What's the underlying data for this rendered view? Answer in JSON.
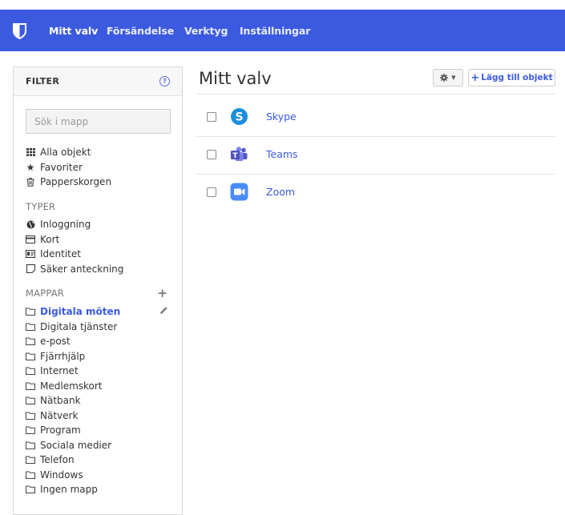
{
  "nav": {
    "items": [
      "Mitt valv",
      "Försändelse",
      "Verktyg",
      "Inställningar"
    ],
    "active": "Mitt valv",
    "brand_color": "#3c5ae0"
  },
  "sidebar": {
    "title": "FILTER",
    "help_icon": "question-circle-icon",
    "search_placeholder": "Sök i mapp",
    "all_items": [
      {
        "label": "Alla objekt",
        "icon": "grid-icon"
      },
      {
        "label": "Favoriter",
        "icon": "star-icon"
      },
      {
        "label": "Papperskorgen",
        "icon": "trash-icon"
      }
    ],
    "types_label": "TYPER",
    "types": [
      {
        "label": "Inloggning",
        "icon": "globe-icon"
      },
      {
        "label": "Kort",
        "icon": "credit-card-icon"
      },
      {
        "label": "Identitet",
        "icon": "id-card-icon"
      },
      {
        "label": "Säker anteckning",
        "icon": "note-icon"
      }
    ],
    "folders_label": "MAPPAR",
    "folders": [
      "Digitala möten",
      "Digitala tjänster",
      "e-post",
      "Fjärrhjälp",
      "Internet",
      "Medlemskort",
      "Nätbank",
      "Nätverk",
      "Program",
      "Sociala medier",
      "Telefon",
      "Windows",
      "Ingen mapp"
    ],
    "active_folder": "Digitala möten"
  },
  "main": {
    "title": "Mitt valv",
    "add_label": "Lägg till objekt",
    "gear_icon": "gear-icon",
    "items": [
      {
        "name": "Skype",
        "icon": "skype-icon"
      },
      {
        "name": "Teams",
        "icon": "teams-icon"
      },
      {
        "name": "Zoom",
        "icon": "zoom-icon"
      }
    ]
  }
}
